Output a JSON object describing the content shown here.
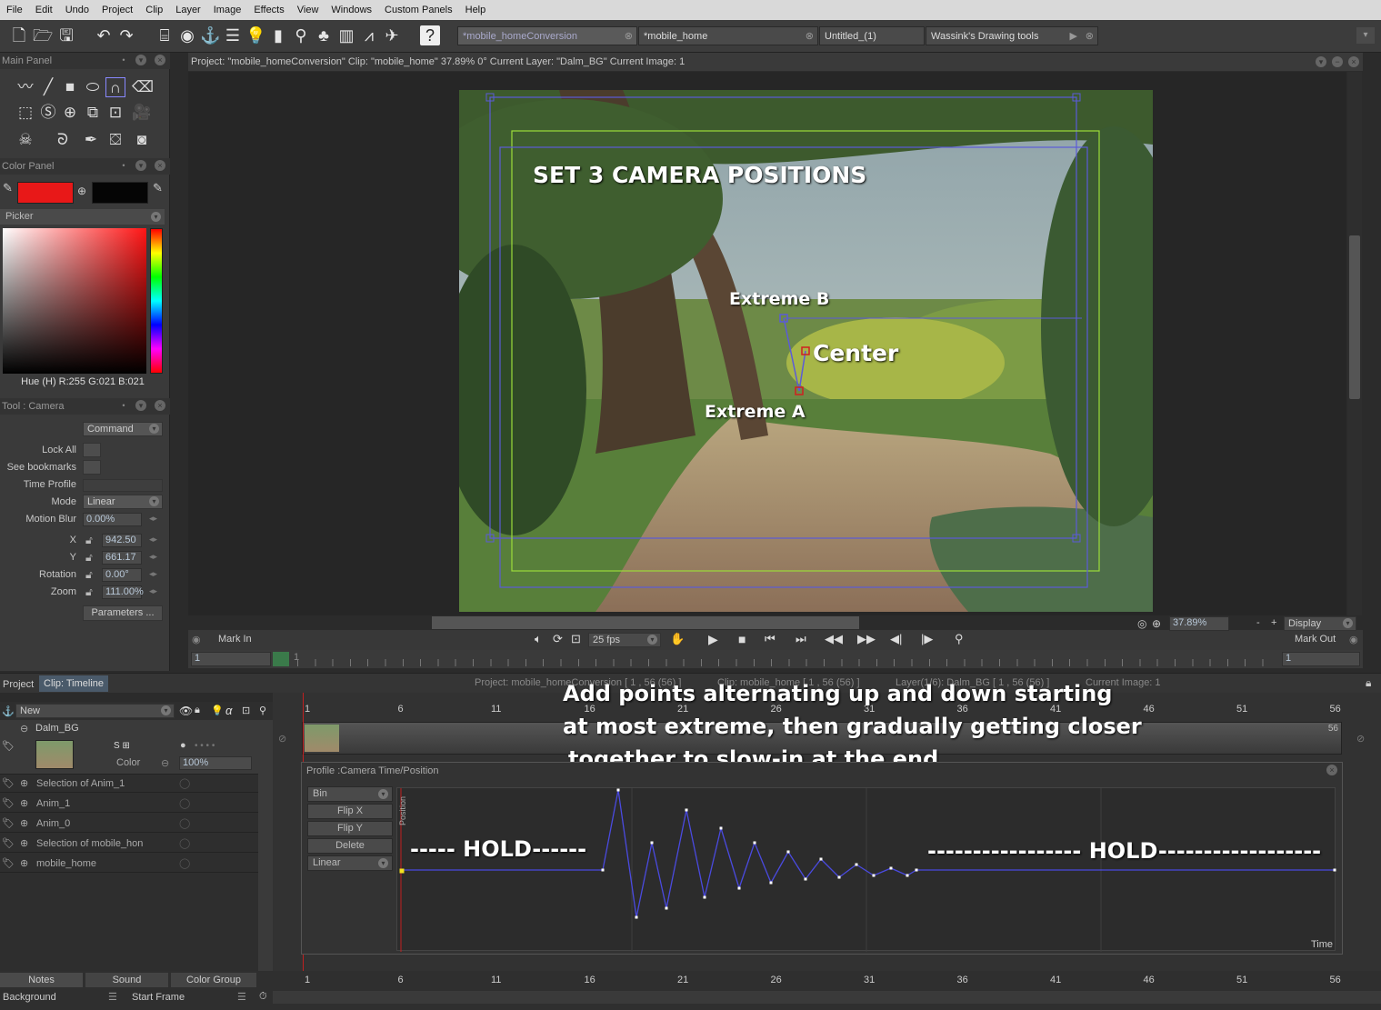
{
  "menu": [
    "File",
    "Edit",
    "Undo",
    "Project",
    "Clip",
    "Layer",
    "Image",
    "Effects",
    "View",
    "Windows",
    "Custom Panels",
    "Help"
  ],
  "doc_tabs": [
    {
      "label": "*mobile_homeConversion"
    },
    {
      "label": "*mobile_home"
    },
    {
      "label": "Untitled_(1)"
    },
    {
      "label": "Wassink's Drawing tools"
    }
  ],
  "panels": {
    "main": "Main Panel",
    "color": "Color Panel",
    "picker": "Picker",
    "tool": "Tool : Camera"
  },
  "color": {
    "primary": "#e81818",
    "secondary": "#050505",
    "hue_readout": "Hue (H) R:255 G:021 B:021"
  },
  "tool_camera": {
    "command": "Command",
    "lock_all": "Lock All",
    "see_bookmarks": "See bookmarks",
    "time_profile": "Time Profile",
    "mode_label": "Mode",
    "mode_value": "Linear",
    "motion_blur_label": "Motion Blur",
    "motion_blur_value": "0.00%",
    "x_label": "X",
    "x_value": "942.50",
    "y_label": "Y",
    "y_value": "661.17",
    "rotation_label": "Rotation",
    "rotation_value": "0.00°",
    "zoom_label": "Zoom",
    "zoom_value": "111.00%",
    "parameters": "Parameters ..."
  },
  "viewer": {
    "header": "Project: \"mobile_homeConversion\" Clip: \"mobile_home\" 37.89% 0° Current Layer: \"Dalm_BG\" Current Image: 1",
    "title_annotation": "SET 3 CAMERA POSITIONS",
    "extreme_b": "Extreme B",
    "center": "Center",
    "extreme_a": "Extreme A",
    "mark_in": "Mark In",
    "mark_out": "Mark Out",
    "fps": "25 fps",
    "zoom": "37.89%",
    "display": "Display",
    "in_value": "1",
    "out_value": "1",
    "range_tick": "1"
  },
  "tabs_mid": {
    "project": "Project",
    "timeline": "Clip: Timeline"
  },
  "timeline_info": {
    "project": "Project: mobile_homeConversion [ 1 , 56 (56) ]",
    "clip": "Clip: mobile_home [ 1 , 56 (56) ]",
    "layer": "Layer(1/6): Dalm_BG [ 1 , 56 (56) ]",
    "current": "Current Image: 1"
  },
  "layers": {
    "new": "New",
    "dalm": "Dalm_BG",
    "color_label": "Color",
    "opacity": "100%",
    "rows": [
      "Selection of Anim_1",
      "Anim_1",
      "Anim_0",
      "Selection of mobile_hon",
      "mobile_home"
    ]
  },
  "frame_ticks": [
    "1",
    "6",
    "11",
    "16",
    "21",
    "26",
    "31",
    "36",
    "41",
    "46",
    "51",
    "56"
  ],
  "track_end": "56",
  "instruction": [
    "Add points alternating up and down starting",
    "at most extreme, then gradually getting closer",
    "together to slow-in at the end"
  ],
  "profile": {
    "title": "Profile :Camera Time/Position",
    "buttons": [
      "Bin",
      "Flip X",
      "Flip Y",
      "Delete",
      "Linear"
    ],
    "y_axis": "Position",
    "x_axis": "Time",
    "hold_left": "----- HOLD------",
    "hold_right": "----------------- HOLD------------------"
  },
  "bottom": {
    "notes": "Notes",
    "sound": "Sound",
    "color_group": "Color Group",
    "background": "Background",
    "start_frame": "Start Frame"
  }
}
